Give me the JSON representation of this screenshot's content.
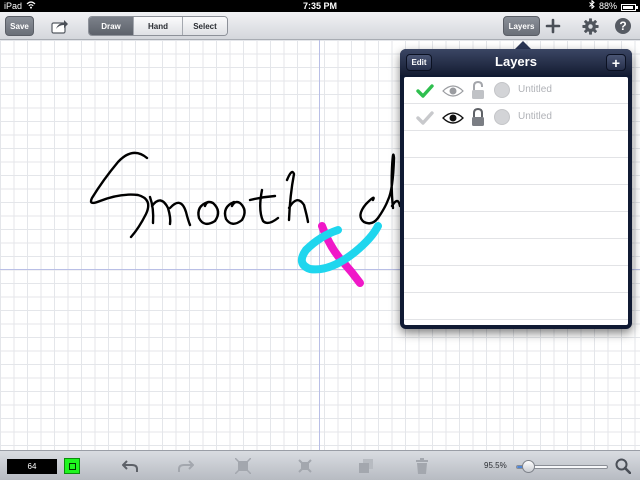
{
  "status_bar": {
    "device": "iPad",
    "time": "7:35 PM",
    "battery": "88%",
    "battery_level": 0.88
  },
  "toolbar": {
    "save_label": "Save",
    "modes": [
      {
        "label": "Draw",
        "active": true
      },
      {
        "label": "Hand",
        "active": false
      },
      {
        "label": "Select",
        "active": false
      }
    ],
    "layers_label": "Layers",
    "icons": [
      "share-icon",
      "plus-icon",
      "gear-icon",
      "help-icon"
    ]
  },
  "canvas": {
    "drawing": [
      "black-ink-stroke",
      "magenta-stroke",
      "cyan-stroke"
    ],
    "colors": {
      "ink": "#000000",
      "magenta": "#f018c8",
      "cyan": "#1fd6ee"
    }
  },
  "layers_panel": {
    "title": "Layers",
    "edit_label": "Edit",
    "add_label": "+",
    "layers": [
      {
        "name": "Untitled",
        "selected": true,
        "visible": true,
        "locked": false
      },
      {
        "name": "Untitled",
        "selected": false,
        "visible": true,
        "locked": true
      }
    ],
    "empty_rows": 7,
    "accent": "#2fbf4f"
  },
  "bottom_bar": {
    "brush_size": "64",
    "brush_color": "#1ff51f",
    "zoom": "95.5%",
    "zoom_level": 0.12,
    "icons": [
      "undo-icon",
      "redo-icon",
      "flip-icon",
      "crop-icon",
      "copy-icon",
      "trash-icon",
      "zoom-icon"
    ]
  }
}
